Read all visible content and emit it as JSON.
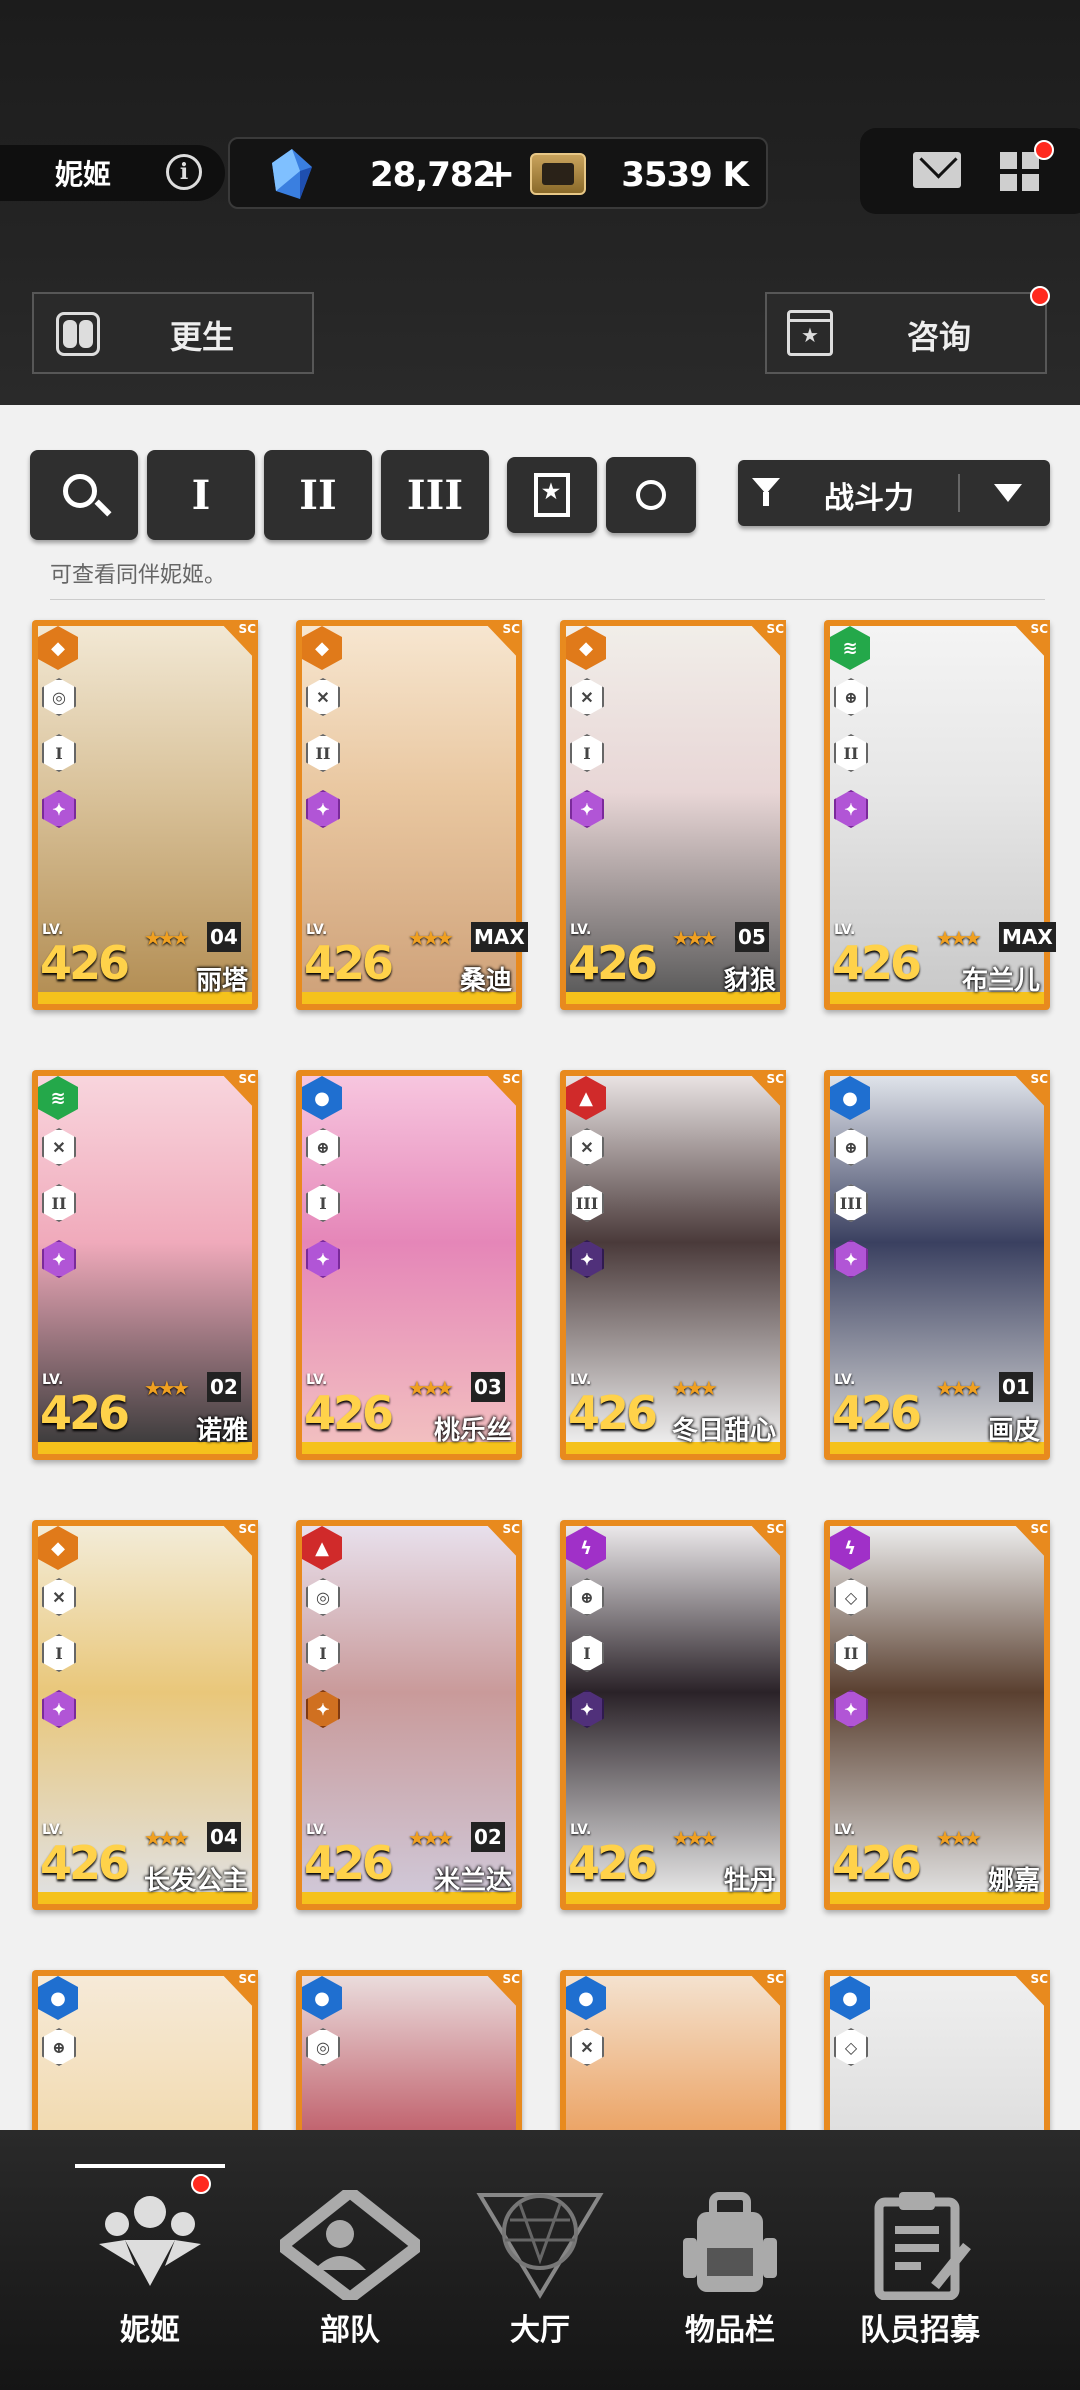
{
  "header": {
    "player_name": "妮姬",
    "gems": "28,782",
    "gem_plus": "+",
    "credits": "3539 K"
  },
  "section_buttons": {
    "left_label": "更生",
    "right_label": "咨询"
  },
  "filters": {
    "tier1": "I",
    "tier2": "II",
    "tier3": "III",
    "sort_label": "战斗力",
    "hint": "可查看同伴妮姬。"
  },
  "cards": [
    {
      "name": "丽塔",
      "level": "426",
      "lv_label": "LV.",
      "burst": "04",
      "element": "#e07a1a",
      "element_symbol": "◆",
      "role1": "◎",
      "role2": "I",
      "role3": "purple"
    },
    {
      "name": "桑迪",
      "level": "426",
      "lv_label": "LV.",
      "burst": "MAX",
      "element": "#e07a1a",
      "element_symbol": "◆",
      "role1": "✕",
      "role2": "II",
      "role3": "purple"
    },
    {
      "name": "豺狼",
      "level": "426",
      "lv_label": "LV.",
      "burst": "05",
      "element": "#e07a1a",
      "element_symbol": "◆",
      "role1": "✕",
      "role2": "I",
      "role3": "purple"
    },
    {
      "name": "布兰儿",
      "level": "426",
      "lv_label": "LV.",
      "burst": "MAX",
      "element": "#24a84a",
      "element_symbol": "≋",
      "role1": "⊕",
      "role2": "II",
      "role3": "purple"
    },
    {
      "name": "诺雅",
      "level": "426",
      "lv_label": "LV.",
      "burst": "02",
      "element": "#24a84a",
      "element_symbol": "≋",
      "role1": "✕",
      "role2": "II",
      "role3": "purple"
    },
    {
      "name": "桃乐丝",
      "level": "426",
      "lv_label": "LV.",
      "burst": "03",
      "element": "#1f6fd0",
      "element_symbol": "●",
      "role1": "⊕",
      "role2": "I",
      "role3": "purple"
    },
    {
      "name": "冬日甜心",
      "level": "426",
      "lv_label": "LV.",
      "burst": "",
      "element": "#d02a2a",
      "element_symbol": "▲",
      "role1": "✕",
      "role2": "III",
      "role3": "dark"
    },
    {
      "name": "画皮",
      "level": "426",
      "lv_label": "LV.",
      "burst": "01",
      "element": "#1f6fd0",
      "element_symbol": "●",
      "role1": "⊕",
      "role2": "III",
      "role3": "purple"
    },
    {
      "name": "长发公主",
      "level": "426",
      "lv_label": "LV.",
      "burst": "04",
      "element": "#e07a1a",
      "element_symbol": "◆",
      "role1": "✕",
      "role2": "I",
      "role3": "purple"
    },
    {
      "name": "米兰达",
      "level": "426",
      "lv_label": "LV.",
      "burst": "02",
      "element": "#d02a2a",
      "element_symbol": "▲",
      "role1": "◎",
      "role2": "I",
      "role3": "orange"
    },
    {
      "name": "牡丹",
      "level": "426",
      "lv_label": "LV.",
      "burst": "",
      "element": "#a030c8",
      "element_symbol": "ϟ",
      "role1": "⊕",
      "role2": "I",
      "role3": "dark"
    },
    {
      "name": "娜嘉",
      "level": "426",
      "lv_label": "LV.",
      "burst": "",
      "element": "#a030c8",
      "element_symbol": "ϟ",
      "role1": "◇",
      "role2": "II",
      "role3": "purple"
    },
    {
      "name": "",
      "level": "",
      "lv_label": "",
      "burst": "",
      "element": "#1f6fd0",
      "element_symbol": "●",
      "role1": "⊕",
      "role2": "",
      "role3": ""
    },
    {
      "name": "",
      "level": "",
      "lv_label": "",
      "burst": "",
      "element": "#1f6fd0",
      "element_symbol": "●",
      "role1": "◎",
      "role2": "",
      "role3": ""
    },
    {
      "name": "",
      "level": "",
      "lv_label": "",
      "burst": "",
      "element": "#1f6fd0",
      "element_symbol": "●",
      "role1": "✕",
      "role2": "",
      "role3": ""
    },
    {
      "name": "",
      "level": "",
      "lv_label": "",
      "burst": "",
      "element": "#1f6fd0",
      "element_symbol": "●",
      "role1": "◇",
      "role2": "",
      "role3": ""
    }
  ],
  "nav": {
    "items": [
      {
        "label": "妮姬"
      },
      {
        "label": "部队"
      },
      {
        "label": "大厅"
      },
      {
        "label": "物品栏"
      },
      {
        "label": "队员招募"
      }
    ]
  }
}
